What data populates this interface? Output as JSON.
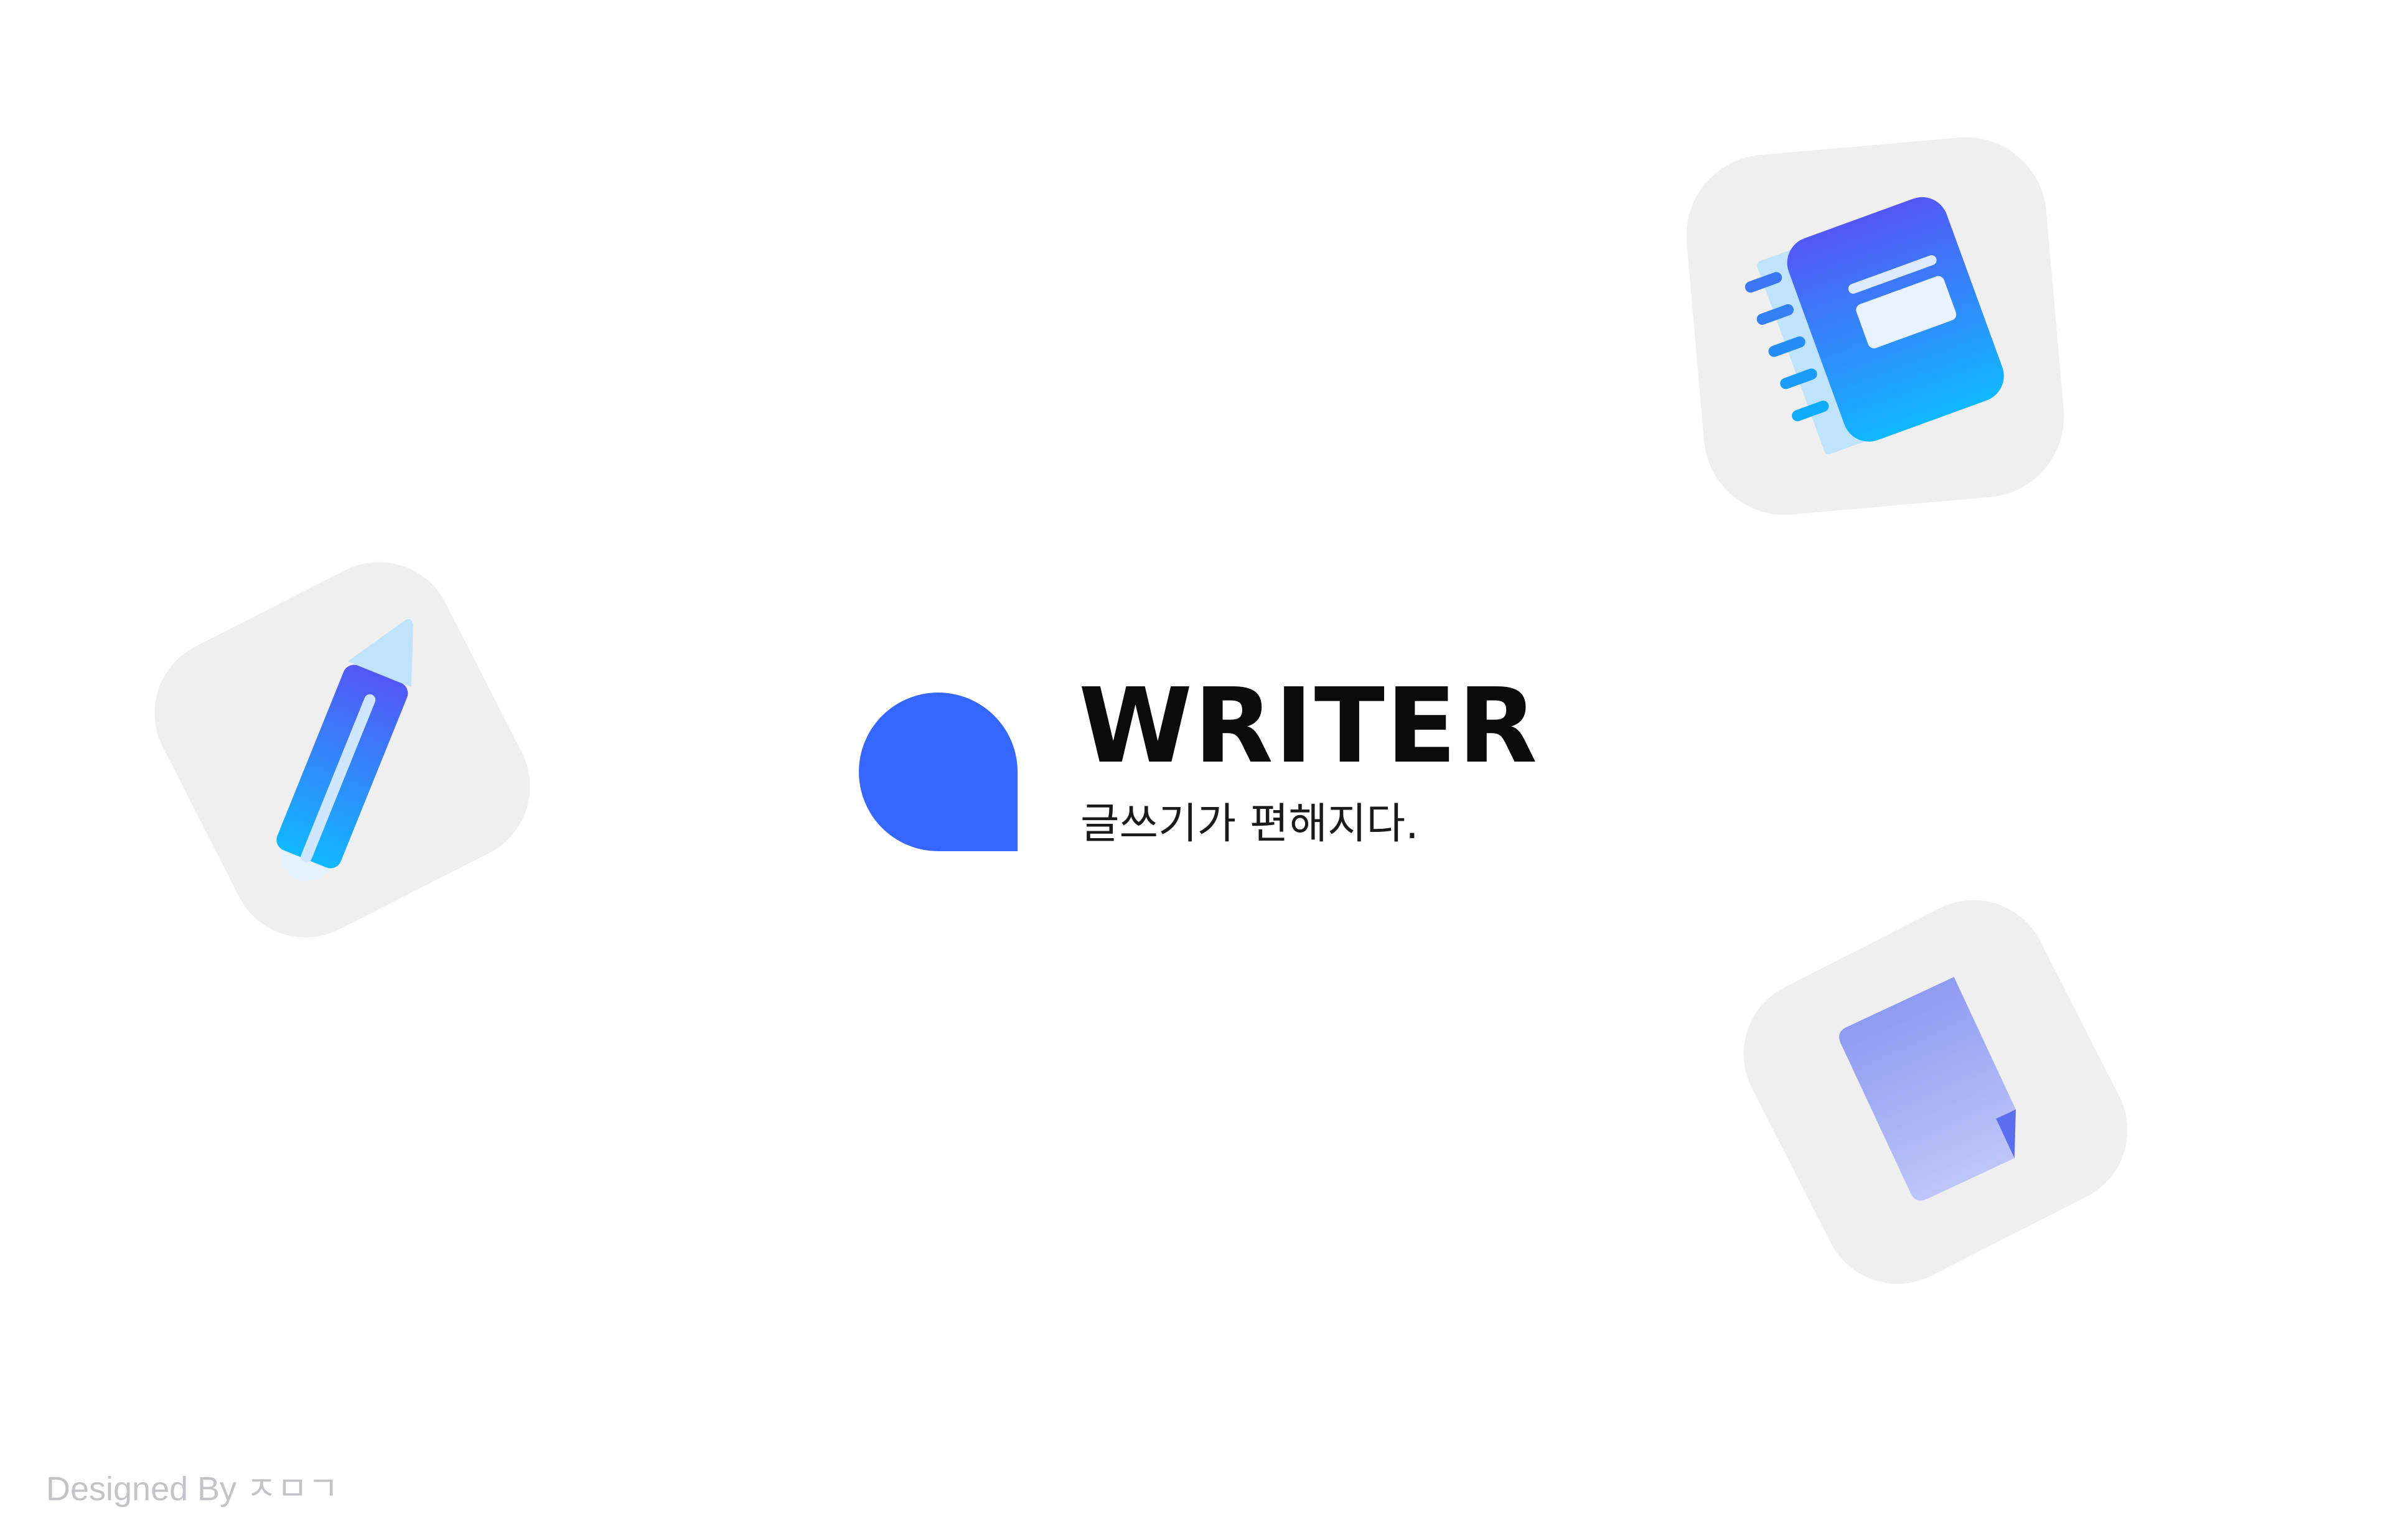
{
  "brand": {
    "title": "WRITER",
    "tagline": "글쓰기가 편해지다.",
    "accent": "#3566FF"
  },
  "credit": {
    "text": "Designed By ㅈㅁㄱ"
  },
  "icons": {
    "pencil": "pencil-icon",
    "notebook": "notebook-icon",
    "document": "document-icon"
  },
  "colors": {
    "tile": "#EFEFEF",
    "gradient_start": "#5457F5",
    "gradient_end": "#10B8FF",
    "document_top": "#8E9BF0",
    "document_bottom": "#BEC6F8"
  }
}
